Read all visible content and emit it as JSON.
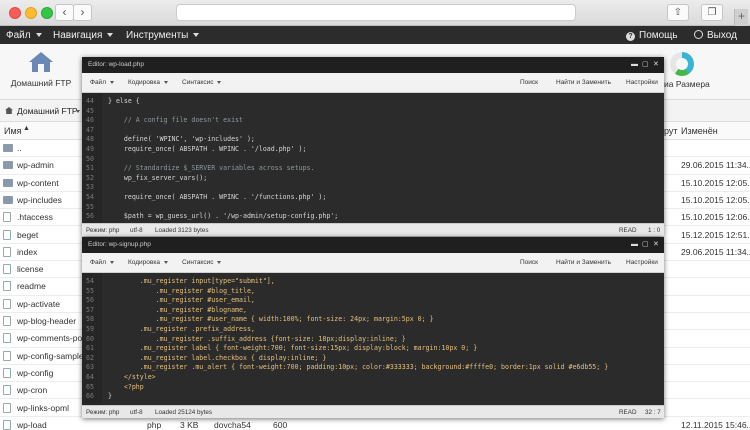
{
  "menubar": {
    "file": "Файл",
    "nav": "Навигация",
    "tools": "Инструменты",
    "help": "Помощь",
    "logout": "Выход"
  },
  "toolbar": {
    "home": "Домашний FTP",
    "size_suffix": "иа Размера"
  },
  "breadcrumb": {
    "root": "Домашний FTP"
  },
  "columns": {
    "name": "Имя",
    "perm": "рут",
    "modified": "Изменён"
  },
  "files": [
    {
      "name": "..",
      "type": "folder",
      "date": ""
    },
    {
      "name": "wp-admin",
      "type": "folder",
      "date": "29.06.2015 11:34..."
    },
    {
      "name": "wp-content",
      "type": "folder",
      "date": "15.10.2015 12:05..."
    },
    {
      "name": "wp-includes",
      "type": "folder",
      "date": "15.10.2015 12:05..."
    },
    {
      "name": ".htaccess",
      "type": "file",
      "date": "15.10.2015 12:06..."
    },
    {
      "name": "beget",
      "type": "file",
      "date": "15.12.2015 12:51..."
    },
    {
      "name": "index",
      "type": "file",
      "date": "29.06.2015 11:34..."
    },
    {
      "name": "license",
      "type": "file",
      "date": ""
    },
    {
      "name": "readme",
      "type": "file",
      "date": ""
    },
    {
      "name": "wp-activate",
      "type": "file",
      "date": ""
    },
    {
      "name": "wp-blog-header",
      "type": "file",
      "date": ""
    },
    {
      "name": "wp-comments-post",
      "type": "file",
      "date": ""
    },
    {
      "name": "wp-config-sample",
      "type": "file",
      "date": ""
    },
    {
      "name": "wp-config",
      "type": "file",
      "date": ""
    },
    {
      "name": "wp-cron",
      "type": "file",
      "date": ""
    },
    {
      "name": "wp-links-opml",
      "type": "file",
      "date": ""
    },
    {
      "name": "wp-load",
      "type": "file",
      "date": "12.11.2015 15:46..."
    }
  ],
  "last_row": {
    "ext": "php",
    "size": "3 KB",
    "owner": "dovcha54",
    "perm": "600"
  },
  "editor1": {
    "title": "Editor: wp-load.php",
    "menu": {
      "file": "Файл",
      "encoding": "Кодировка",
      "syntax": "Синтаксис",
      "search": "Поиск",
      "replace": "Найти и Заменить",
      "settings": "Настройки"
    },
    "lines": [
      {
        "n": "44",
        "t": "} else {"
      },
      {
        "n": "45",
        "t": ""
      },
      {
        "n": "46",
        "t": "    // A config file doesn't exist"
      },
      {
        "n": "47",
        "t": ""
      },
      {
        "n": "48",
        "t": "    define( 'WPINC', 'wp-includes' );"
      },
      {
        "n": "49",
        "t": "    require_once( ABSPATH . WPINC . '/load.php' );"
      },
      {
        "n": "50",
        "t": ""
      },
      {
        "n": "51",
        "t": "    // Standardize $_SERVER variables across setups."
      },
      {
        "n": "52",
        "t": "    wp_fix_server_vars();"
      },
      {
        "n": "53",
        "t": ""
      },
      {
        "n": "54",
        "t": "    require_once( ABSPATH . WPINC . '/functions.php' );"
      },
      {
        "n": "55",
        "t": ""
      },
      {
        "n": "56",
        "t": "    $path = wp_guess_url() . '/wp-admin/setup-config.php';"
      }
    ],
    "status": {
      "mode": "Режим: php",
      "enc": "utf-8",
      "loaded": "Loaded 3123 bytes",
      "rw": "READ",
      "pos": "1 : 0"
    }
  },
  "editor2": {
    "title": "Editor: wp-signup.php",
    "menu": {
      "file": "Файл",
      "encoding": "Кодировка",
      "syntax": "Синтаксис",
      "search": "Поиск",
      "replace": "Найти и Заменить",
      "settings": "Настройки"
    },
    "lines": [
      {
        "n": "54",
        "t": "        .mu_register input[type=\"submit\"],"
      },
      {
        "n": "55",
        "t": "            .mu_register #blog_title,"
      },
      {
        "n": "56",
        "t": "            .mu_register #user_email,"
      },
      {
        "n": "57",
        "t": "            .mu_register #blogname,"
      },
      {
        "n": "58",
        "t": "            .mu_register #user_name { width:100%; font-size: 24px; margin:5px 0; }"
      },
      {
        "n": "59",
        "t": "        .mu_register .prefix_address,"
      },
      {
        "n": "60",
        "t": "            .mu_register .suffix_address {font-size: 18px;display:inline; }"
      },
      {
        "n": "61",
        "t": "        .mu_register label { font-weight:700; font-size:15px; display:block; margin:10px 0; }"
      },
      {
        "n": "62",
        "t": "        .mu_register label.checkbox { display:inline; }"
      },
      {
        "n": "63",
        "t": "        .mu_register .mu_alert { font-weight:700; padding:10px; color:#333333; background:#ffffe0; border:1px solid #e6db55; }"
      },
      {
        "n": "64",
        "t": "    </style>"
      },
      {
        "n": "65",
        "t": "    <?php"
      },
      {
        "n": "66",
        "t": "}"
      }
    ],
    "status": {
      "mode": "Режим: php",
      "enc": "utf-8",
      "loaded": "Loaded 25124 bytes",
      "rw": "READ",
      "pos": "32 : 7"
    }
  },
  "colors": {
    "menubar": "#2c2c2c",
    "editor_bg": "#2b2b2b",
    "accent": "#3d8fd9"
  }
}
